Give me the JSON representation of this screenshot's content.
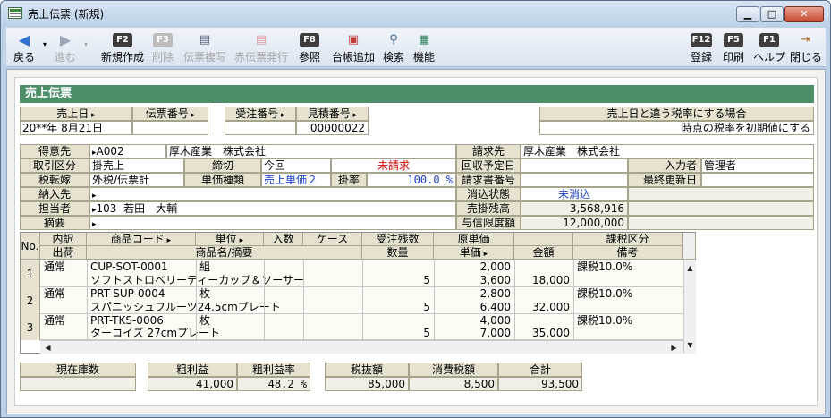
{
  "window": {
    "title": "売上伝票 (新規)",
    "minimize": "▁",
    "maximize": "□",
    "close": "✕"
  },
  "toolbar": {
    "back": {
      "label": "戻る",
      "icon": "arrow-left-icon"
    },
    "forward": {
      "label": "進む",
      "icon": "arrow-right-icon"
    },
    "new": {
      "key": "F2",
      "label": "新規作成"
    },
    "delete": {
      "key": "F3",
      "label": "削除"
    },
    "copy": {
      "label": "伝票複写",
      "icon": "copy-icon"
    },
    "red_slip": {
      "label": "赤伝票発行",
      "icon": "red-slip-icon"
    },
    "reference": {
      "key": "F8",
      "label": "参照"
    },
    "ledger_add": {
      "label": "台帳追加",
      "icon": "ledger-add-icon"
    },
    "search": {
      "label": "検索",
      "icon": "magnifier-icon"
    },
    "functions": {
      "label": "機能",
      "icon": "functions-icon"
    },
    "register": {
      "key": "F12",
      "label": "登録"
    },
    "print": {
      "key": "F5",
      "label": "印刷"
    },
    "help": {
      "key": "F1",
      "label": "ヘルプ"
    },
    "close": {
      "label": "閉じる",
      "icon": "door-exit-icon"
    }
  },
  "form": {
    "section_title": "売上伝票",
    "sales_date_label": "売上日",
    "sales_date": "20**年 8月21日",
    "slip_no_label": "伝票番号",
    "slip_no": "",
    "order_no_label": "受注番号",
    "order_no": "",
    "estimate_no_label": "見積番号",
    "estimate_no": "00000022",
    "tax_rate_header": "売上日と違う税率にする場合",
    "tax_rate_value": "時点の税率を初期値にする",
    "customer_label": "得意先",
    "customer_code": "A002",
    "customer_name": "厚木産業　株式会社",
    "billing_label": "請求先",
    "billing_name": "厚木産業　株式会社",
    "trade_type_label": "取引区分",
    "trade_type": "掛売上",
    "closing_label": "締切",
    "closing": "今回",
    "billing_status": "未請求",
    "collection_date_label": "回収予定日",
    "collection_date": "",
    "entered_by_label": "入力者",
    "entered_by": "管理者",
    "tax_transfer_label": "税転嫁",
    "tax_transfer": "外税/伝票計",
    "unit_price_type_label": "単価種類",
    "unit_price_type": "売上単価２",
    "rate_label": "掛率",
    "rate": "100.0 %",
    "invoice_no_label": "請求書番号",
    "invoice_no": "",
    "last_updated_label": "最終更新日",
    "last_updated": "",
    "delivery_label": "納入先",
    "delivery": "",
    "clear_status_label": "消込状態",
    "clear_status": "未消込",
    "staff_label": "担当者",
    "staff_code": "103",
    "staff_name": "若田　大輔",
    "receivable_label": "売掛残高",
    "receivable": "3,568,916",
    "summary_label": "摘要",
    "summary": "",
    "credit_limit_label": "与信限度額",
    "credit_limit": "12,000,000"
  },
  "grid": {
    "headers": {
      "no": "No.",
      "breakdown": "内訳",
      "shipment": "出荷",
      "product_code": "商品コード",
      "unit": "単位",
      "pack_qty": "入数",
      "case": "ケース",
      "order_remain": "受注残数",
      "quantity": "数量",
      "cost_price": "原単価",
      "unit_price": "単価",
      "amount": "金額",
      "tax_category": "課税区分",
      "remarks": "備考",
      "product_name": "商品名/摘要"
    },
    "rows": [
      {
        "no": "1",
        "breakdown": "通常",
        "code": "CUP-SOT-0001",
        "unit": "組",
        "name": "ソフトストロベリーティーカップ＆ソーサー",
        "quantity": "5",
        "cost": "2,000",
        "price": "3,600",
        "amount": "18,000",
        "tax": "課税10.0%"
      },
      {
        "no": "2",
        "breakdown": "通常",
        "code": "PRT-SUP-0004",
        "unit": "枚",
        "name": "スパニッシュフルーツ24.5cmプレート",
        "quantity": "5",
        "cost": "2,800",
        "price": "6,400",
        "amount": "32,000",
        "tax": "課税10.0%"
      },
      {
        "no": "3",
        "breakdown": "通常",
        "code": "PRT-TKS-0006",
        "unit": "枚",
        "name": "ターコイズ 27cmプレート",
        "quantity": "5",
        "cost": "4,000",
        "price": "7,000",
        "amount": "35,000",
        "tax": "課税10.0%"
      }
    ]
  },
  "totals": {
    "stock_label": "現在庫数",
    "stock": "",
    "gross_profit_label": "粗利益",
    "gross_profit": "41,000",
    "gross_margin_label": "粗利益率",
    "gross_margin": "48.2 %",
    "net_label": "税抜額",
    "net": "85,000",
    "tax_label": "消費税額",
    "tax": "8,500",
    "total_label": "合計",
    "total": "93,500"
  }
}
